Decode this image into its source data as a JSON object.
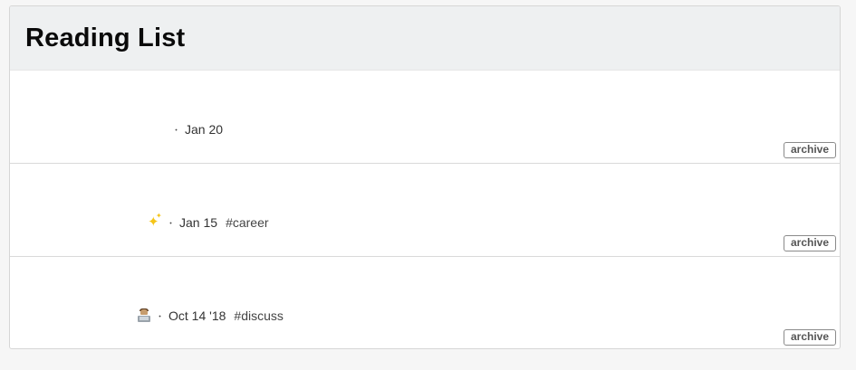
{
  "header": {
    "title": "Reading List"
  },
  "items": [
    {
      "emoji": "",
      "date": "Jan 20",
      "tag": "",
      "archive_label": "archive"
    },
    {
      "emoji": "sparkles-icon",
      "date": "Jan 15",
      "tag": "#career",
      "archive_label": "archive"
    },
    {
      "emoji": "technologist-icon",
      "date": "Oct 14 '18",
      "tag": "#discuss",
      "archive_label": "archive"
    }
  ],
  "separator": "・",
  "colors": {
    "header_bg": "#eef0f1",
    "panel_bg": "#ffffff",
    "page_bg": "#f6f6f6",
    "text": "#333333"
  }
}
